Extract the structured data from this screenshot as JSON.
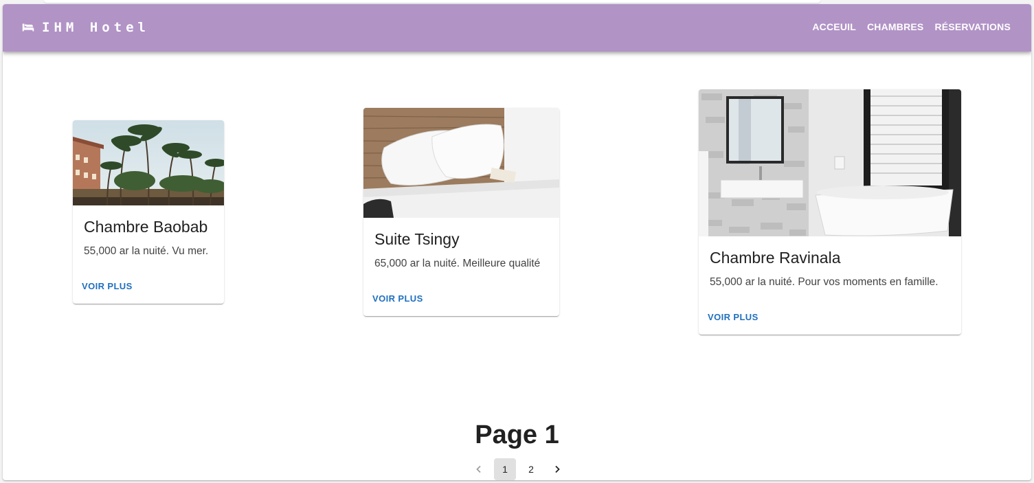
{
  "app": {
    "brand": "IHM Hotel",
    "brand_icon": "bed-icon",
    "appbar_color": "#b193c6",
    "link_color": "#1e6fc0"
  },
  "nav": {
    "items": [
      {
        "label": "ACCEUIL"
      },
      {
        "label": "CHAMBRES"
      },
      {
        "label": "RÉSERVATIONS"
      }
    ]
  },
  "rooms": [
    {
      "title": "Chambre Baobab",
      "description": "55,000 ar la nuité. Vu mer.",
      "action": "VOIR PLUS",
      "image": "palm-trees-resort"
    },
    {
      "title": "Suite Tsingy",
      "description": "65,000 ar la nuité. Meilleure qualité",
      "action": "VOIR PLUS",
      "image": "white-bed-pillows"
    },
    {
      "title": "Chambre Ravinala",
      "description": "55,000 ar la nuité. Pour vos moments en famille.",
      "action": "VOIR PLUS",
      "image": "modern-bathroom"
    }
  ],
  "pagination": {
    "heading": "Page 1",
    "pages": [
      "1",
      "2"
    ],
    "current": "1",
    "prev_icon": "chevron-left-icon",
    "next_icon": "chevron-right-icon"
  }
}
